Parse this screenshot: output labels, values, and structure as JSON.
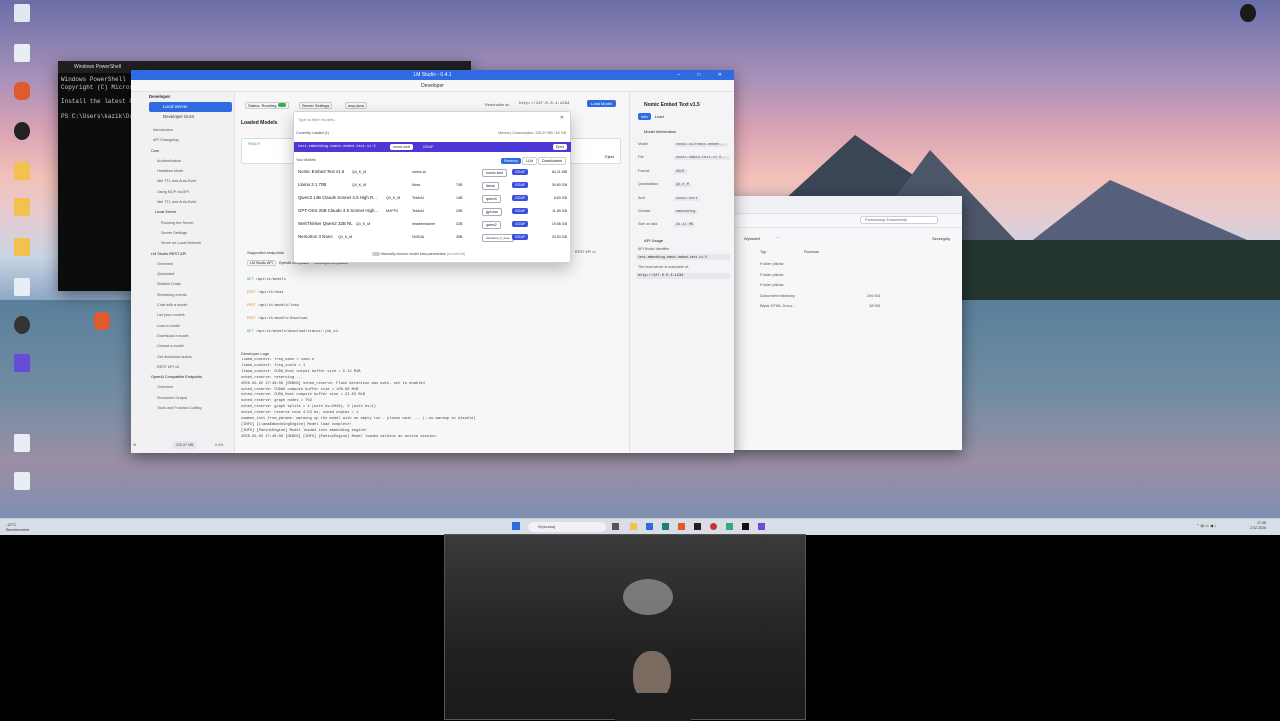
{
  "desktop": {
    "icons": [
      "",
      "",
      "",
      "",
      "",
      "",
      "",
      "",
      "",
      "",
      "",
      "",
      "",
      "",
      "",
      "",
      "",
      ""
    ],
    "top_right_label": ""
  },
  "powershell": {
    "title": "Windows PowerShell",
    "line1": "Windows PowerShell",
    "line2": "Copyright (C) Microso",
    "line3": "Install the latest Po",
    "prompt": "PS C:\\Users\\kazik\\Doc"
  },
  "lmstudio": {
    "title": "LM Studio - 0.4.1",
    "header": "Developer",
    "sidebar": {
      "section": "Developer",
      "local_server": "Local Server",
      "docs": "Developer Docs",
      "items": [
        "Introduction",
        "API Changelog",
        "Core",
        "Authentication",
        "Headless Mode",
        "Idle TTL and Auto-Evict",
        "Using MCP via API",
        "Idle TTL and Auto-Evict",
        "Local Server",
        "Running the Server",
        "Server Settings",
        "Serve on Local Network",
        "LM Studio REST API",
        "Overview",
        "Quickstart",
        "Stateful Chats",
        "Streaming events",
        "Chat with a model",
        "List your models",
        "Load a model",
        "Download a model",
        "Unload a model",
        "Get download status",
        "REST API v0",
        "OpenAI Compatible Endpoints",
        "Overview",
        "Structured Output",
        "Tools and Function Calling"
      ],
      "footer_mem": "226.97 MB",
      "footer_cpu": "0.4%"
    },
    "toolbar": {
      "status": "Status: Running",
      "settings": "Server Settings",
      "mcp": "mcp.json",
      "reachable": "Reachable at:",
      "url": "http://127.0.0.1:1234",
      "load_model": "Load Model"
    },
    "loaded_models_title": "Loaded Models",
    "ready": "READY",
    "eject": "Eject",
    "supported_endpoints": "Supported endpoints",
    "endpoint_tabs": [
      "LM Studio API",
      "OpenAI compatible",
      "Anthropic compatible"
    ],
    "endpoints": [
      {
        "method": "GET",
        "path": "/api/v1/models"
      },
      {
        "method": "POST",
        "path": "/api/v1/chat"
      },
      {
        "method": "POST",
        "path": "/api/v1/models/load"
      },
      {
        "method": "POST",
        "path": "/api/v1/models/download"
      },
      {
        "method": "GET",
        "path": "/api/v1/models/download/status/:job_id"
      }
    ],
    "rest_api": "REST API v1",
    "logs": {
      "title": "Developer Logs",
      "lines": [
        "llama_context: freq_base     = 1000.0",
        "llama_context: freq_scale    = 1",
        "llama_context:  CUDA_Host  output buffer size =     0.12 MiB",
        "sched_reserve: reserving ...",
        "2026-02-02 17:48:09 [DEBUG] sched_reserve: Flash Attention was auto, set to enabled",
        "sched_reserve:      CUDA0 compute buffer size =   108.00 MiB",
        "sched_reserve:  CUDA_Host compute buffer size =    22.03 MiB",
        "sched_reserve: graph nodes  = 759",
        "sched_reserve: graph splits = 4 (with bs=2048), 2 (with bs=1)",
        "sched_reserve: reserve took 4.53 ms, sched copies = 1",
        "common_init_from_params: warming up the model with an empty run - please wait ... (--no-warmup to disable)",
        "[INFO] [LlamaEmbeddingEngine] Model load complete!",
        "[INFO] [PaniniEngine] Model loaded into embedding engine!",
        "2026-02-02 17:48:09 [DEBUG] [INFO] [PaniniEngine] Model loaded without an active session."
      ]
    },
    "info_panel": {
      "model_name": "Nomic Embed Text v1.5",
      "tab_info": "Info",
      "tab_load": "Load",
      "section_model_info": "Model Information",
      "fields": [
        {
          "label": "Model",
          "value": "nomic-ai/nomic-embed..."
        },
        {
          "label": "File",
          "value": "nomic-embed-text-v1.5..."
        },
        {
          "label": "Format",
          "value": "GGUF"
        },
        {
          "label": "Quantization",
          "value": "Q4_K_M"
        },
        {
          "label": "Arch",
          "value": "nomic-bert"
        },
        {
          "label": "Domain",
          "value": "embedding"
        },
        {
          "label": "Size on disk",
          "value": "84.11 MB"
        }
      ],
      "api_usage": "API Usage",
      "api_identifier_label": "API Model Identifier",
      "api_identifier": "text-embedding-nomic-embed-text-v1.5",
      "reachable_text": "The local server is reachable at:",
      "reachable_url": "http://127.0.0.1:1234"
    }
  },
  "modal": {
    "placeholder": "Type to filter models...",
    "currently_loaded": "Currently Loaded (1)",
    "memory": "Memory Consumption: 226.97 MB / 64 GB",
    "loaded_model": "text-embedding-nomic-embed-text-v1.5",
    "loaded_model_badge": "nomic-bert",
    "loaded_model_fmt": "GGUF",
    "eject": "Eject",
    "your_models": "Your Models",
    "filters": [
      "Recency",
      "LLM",
      "Downloaded"
    ],
    "models": [
      {
        "name": "Nomic Embed Text v1.5",
        "quant": "Q4_K_M",
        "arch": "nomic-ai",
        "params": "",
        "tag": "nomic-bert",
        "fmt": "GGUF",
        "size": "84.11 MB"
      },
      {
        "name": "Llama 3.1 70B",
        "quant": "Q4_K_M",
        "arch": "Meta",
        "params": "70B",
        "tag": "llama",
        "fmt": "GGUF",
        "size": "39.60 GB"
      },
      {
        "name": "Qwen3 14B Claude Sonnet 4.5 High R...",
        "quant": "Q4_K_M",
        "arch": "TeichAI",
        "params": "14B",
        "tag": "qwen3",
        "fmt": "GGUF",
        "size": "8.63 GB"
      },
      {
        "name": "GPT-OSS 20B Claude 4.5 Sonnet High...",
        "quant": "MXFP4",
        "arch": "TeichAI",
        "params": "20B",
        "tag": "gpt-oss",
        "fmt": "GGUF",
        "size": "11.89 GB"
      },
      {
        "name": "WebThinker Qwen2 32B RL",
        "quant": "Q4_K_M",
        "arch": "mradermacher",
        "params": "32B",
        "tag": "qwen2",
        "fmt": "GGUF",
        "size": "19.85 GB"
      },
      {
        "name": "Nemotron 3 Nano",
        "quant": "Q4_K_M",
        "arch": "NVIDIA",
        "params": "30B",
        "tag": "nemotron_h_moe",
        "fmt": "GGUF",
        "size": "24.53 GB"
      }
    ],
    "manual_toggle": "Manually choose model load parameters",
    "hold_alt": "(or hold Alt)"
  },
  "explorer": {
    "search_placeholder": "Przeszukaj: Dokumenty",
    "view": "Wyświetl",
    "details": "Szczegóły",
    "col_type": "Typ",
    "col_size": "Rozmiar",
    "rows": [
      {
        "type": "Folder plików",
        "size": ""
      },
      {
        "type": "Folder plików",
        "size": ""
      },
      {
        "type": "Folder plików",
        "size": ""
      },
      {
        "type": "Dokument tekstowy",
        "size": "206 KB"
      },
      {
        "type": "Błysk HTML Docu...",
        "size": "38 KB"
      }
    ]
  },
  "taskbar": {
    "weather_temp": "-12°C",
    "weather_desc": "Bezchmurnie",
    "search": "Wyszukaj",
    "time": "17:48",
    "date": "2.02.2026"
  }
}
